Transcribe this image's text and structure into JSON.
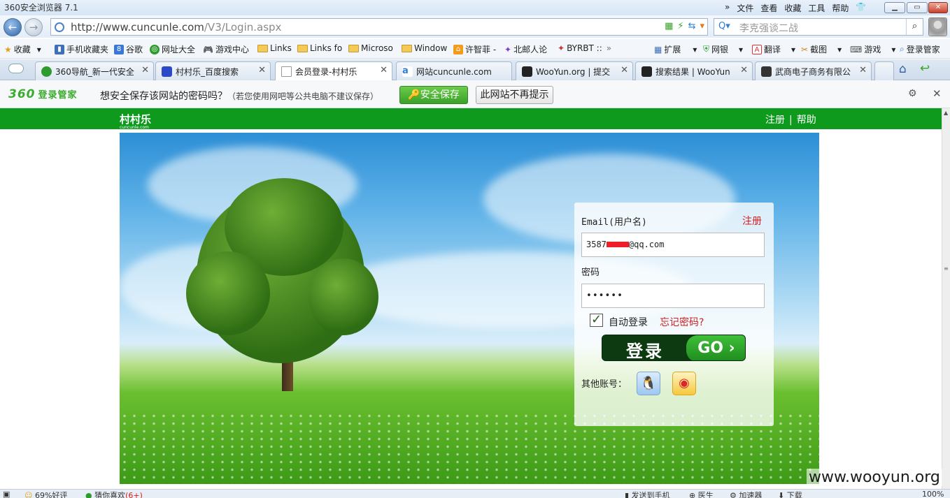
{
  "browser": {
    "title": "360安全浏览器 7.1",
    "menus": [
      "文件",
      "查看",
      "收藏",
      "工具",
      "帮助"
    ],
    "url_host": "http://www.cuncunle.com",
    "url_path": "/V3/Login.aspx",
    "search_placeholder": "李克强谈二战"
  },
  "favorites": [
    {
      "label": "收藏",
      "icon": "star-icon"
    },
    {
      "label": "手机收藏夹",
      "icon": "phone-icon"
    },
    {
      "label": "谷歌",
      "icon": "google-icon"
    },
    {
      "label": "网址大全",
      "icon": "360-nav-icon"
    },
    {
      "label": "游戏中心",
      "icon": "gamepad-icon"
    },
    {
      "label": "Links",
      "icon": "folder-icon"
    },
    {
      "label": "Links fo",
      "icon": "folder-icon"
    },
    {
      "label": "Microso",
      "icon": "folder-icon"
    },
    {
      "label": "Window",
      "icon": "folder-icon"
    },
    {
      "label": "许智菲 -",
      "icon": "home-icon"
    },
    {
      "label": "北邮人论",
      "icon": "butterfly-icon"
    },
    {
      "label": "BYRBT ::",
      "icon": "butterfly-icon"
    }
  ],
  "fav_right": [
    {
      "label": "扩展"
    },
    {
      "label": "网银"
    },
    {
      "label": "翻译"
    },
    {
      "label": "截图"
    },
    {
      "label": "游戏"
    },
    {
      "label": "登录管家"
    }
  ],
  "tabs": [
    {
      "label": "360导航_新一代安全"
    },
    {
      "label": "村村乐_百度搜索"
    },
    {
      "label": "会员登录-村村乐"
    },
    {
      "label": "网站cuncunle.com"
    },
    {
      "label": "WooYun.org | 提交"
    },
    {
      "label": "搜索结果 | WooYun"
    },
    {
      "label": "武商电子商务有限公"
    }
  ],
  "password_bar": {
    "brand": "360",
    "brand_sub": "登录管家",
    "question": "想安全保存该网站的密码吗？",
    "note": "（若您使用网吧等公共电脑不建议保存）",
    "save_label": "安全保存",
    "never_label": "此网站不再提示"
  },
  "site": {
    "logo": "村村乐",
    "logo_domain": "cuncunle.com",
    "register": "注册",
    "help": "帮助",
    "separator": "|"
  },
  "login": {
    "email_label": "Email(用户名)",
    "register": "注册",
    "email_prefix": "3587",
    "email_suffix": "@qq.com",
    "password_label": "密码",
    "password_value": "••••••",
    "auto_login": "自动登录",
    "forgot": "忘记密码?",
    "login_button": "登录",
    "go": "GO ›",
    "other_accounts": "其他账号："
  },
  "status": {
    "rating": "69%好评",
    "guess": "猜你喜欢",
    "count": "(6+)",
    "send": "发送到手机",
    "doctor": "医生",
    "accelerator": "加速器",
    "download": "下载",
    "zoom": "100%"
  },
  "watermark": "www.wooyun.org"
}
